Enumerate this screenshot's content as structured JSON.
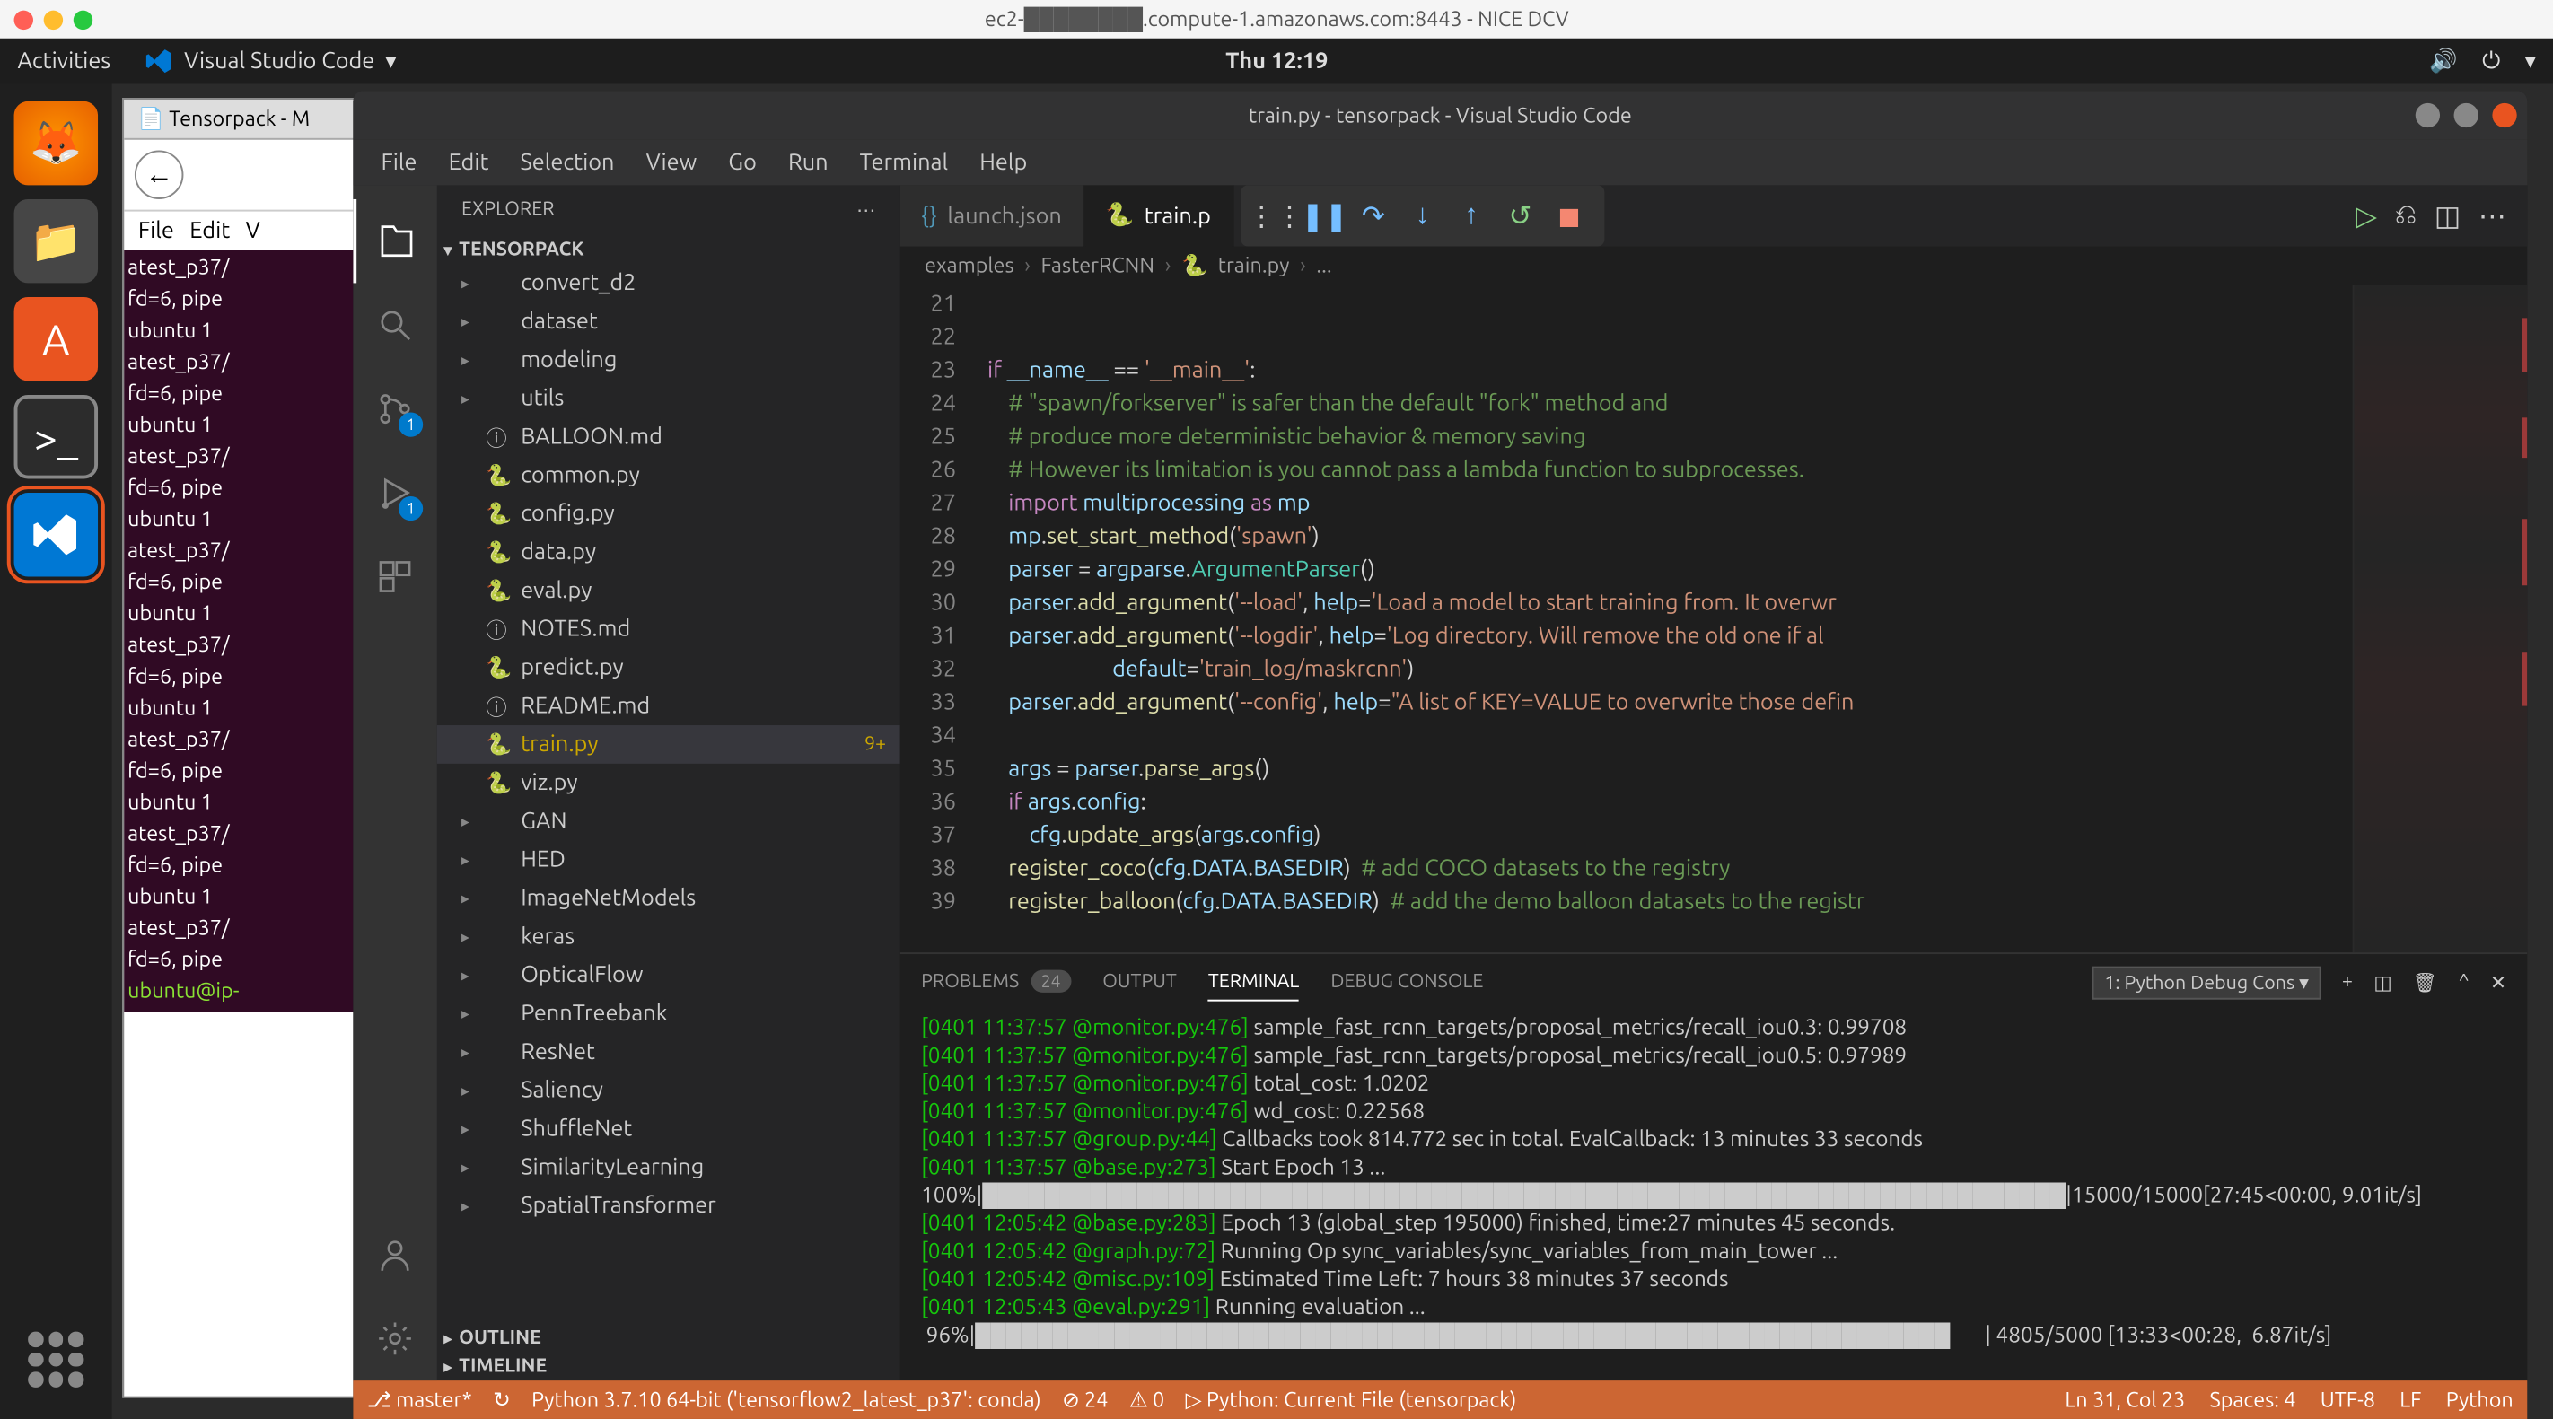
{
  "browser": {
    "title": "ec2-████████.compute-1.amazonaws.com:8443 - NICE DCV"
  },
  "ubuntu": {
    "activities": "Activities",
    "app_name": "Visual Studio Code",
    "time": "Thu 12:19"
  },
  "bg_window": {
    "tab": "Tensorpack - M",
    "menu": [
      "File",
      "Edit",
      "V"
    ],
    "terminal_lines": [
      "atest_p37/",
      "fd=6, pipe",
      "ubuntu   1",
      "atest_p37/",
      "fd=6, pipe",
      "ubuntu   1",
      "atest_p37/",
      "fd=6, pipe",
      "ubuntu   1",
      "atest_p37/",
      "fd=6, pipe",
      "ubuntu   1",
      "atest_p37/",
      "fd=6, pipe",
      "ubuntu   1",
      "atest_p37/",
      "fd=6, pipe",
      "ubuntu   1",
      "atest_p37/",
      "fd=6, pipe",
      "ubuntu   1",
      "atest_p37/",
      "fd=6, pipe",
      "ubuntu@ip-"
    ]
  },
  "vscode": {
    "title": "train.py - tensorpack - Visual Studio Code",
    "menus": [
      "File",
      "Edit",
      "Selection",
      "View",
      "Go",
      "Run",
      "Terminal",
      "Help"
    ],
    "explorer_title": "EXPLORER",
    "project": "TENSORPACK",
    "scm_badge": "1",
    "run_badge": "1",
    "tree": [
      {
        "name": "convert_d2",
        "type": "folder"
      },
      {
        "name": "dataset",
        "type": "folder"
      },
      {
        "name": "modeling",
        "type": "folder"
      },
      {
        "name": "utils",
        "type": "folder"
      },
      {
        "name": "BALLOON.md",
        "type": "file",
        "icon": "ⓘ"
      },
      {
        "name": "common.py",
        "type": "file",
        "icon": "🐍"
      },
      {
        "name": "config.py",
        "type": "file",
        "icon": "🐍"
      },
      {
        "name": "data.py",
        "type": "file",
        "icon": "🐍"
      },
      {
        "name": "eval.py",
        "type": "file",
        "icon": "🐍"
      },
      {
        "name": "NOTES.md",
        "type": "file",
        "icon": "ⓘ"
      },
      {
        "name": "predict.py",
        "type": "file",
        "icon": "🐍"
      },
      {
        "name": "README.md",
        "type": "file",
        "icon": "ⓘ"
      },
      {
        "name": "train.py",
        "type": "file",
        "icon": "🐍",
        "active": true,
        "modified": true,
        "badge": "9+"
      },
      {
        "name": "viz.py",
        "type": "file",
        "icon": "🐍"
      },
      {
        "name": "GAN",
        "type": "folder"
      },
      {
        "name": "HED",
        "type": "folder"
      },
      {
        "name": "ImageNetModels",
        "type": "folder"
      },
      {
        "name": "keras",
        "type": "folder"
      },
      {
        "name": "OpticalFlow",
        "type": "folder"
      },
      {
        "name": "PennTreebank",
        "type": "folder"
      },
      {
        "name": "ResNet",
        "type": "folder"
      },
      {
        "name": "Saliency",
        "type": "folder"
      },
      {
        "name": "ShuffleNet",
        "type": "folder"
      },
      {
        "name": "SimilarityLearning",
        "type": "folder"
      },
      {
        "name": "SpatialTransformer",
        "type": "folder"
      }
    ],
    "outline": "OUTLINE",
    "timeline": "TIMELINE",
    "tabs": [
      {
        "label": "launch.json",
        "icon": "{}"
      },
      {
        "label": "train.p",
        "icon": "🐍",
        "active": true
      }
    ],
    "breadcrumbs": [
      "examples",
      "FasterRCNN",
      "train.py",
      "..."
    ],
    "line_start": 21,
    "code_lines": [
      "",
      "",
      "<span class='kw'>if</span> <span class='var'>__name__</span> <span class='op'>==</span> <span class='str'>'__main__'</span>:",
      "    <span class='cmt'># \"spawn/forkserver\" is safer than the default \"fork\" method and</span>",
      "    <span class='cmt'># produce more deterministic behavior & memory saving</span>",
      "    <span class='cmt'># However its limitation is you cannot pass a lambda function to subprocesses.</span>",
      "    <span class='kw'>import</span> <span class='var'>multiprocessing</span> <span class='kw'>as</span> <span class='var'>mp</span>",
      "    <span class='var'>mp</span>.<span class='fn'>set_start_method</span>(<span class='str'>'spawn'</span>)",
      "    <span class='var'>parser</span> = <span class='var'>argparse</span>.<span class='cls'>ArgumentParser</span>()",
      "    <span class='var'>parser</span>.<span class='fn'>add_argument</span>(<span class='str'>'--load'</span>, <span class='var'>help</span>=<span class='str'>'Load a model to start training from. It overwr</span>",
      "    <span class='var'>parser</span>.<span class='fn'>add_argument</span>(<span class='str'>'--logdir'</span>, <span class='var'>help</span>=<span class='str'>'Log directory. Will remove the old one if al</span>",
      "                        <span class='var'>default</span>=<span class='str'>'train_log/maskrcnn'</span>)",
      "    <span class='var'>parser</span>.<span class='fn'>add_argument</span>(<span class='str'>'--config'</span>, <span class='var'>help</span>=<span class='str'>\"A list of KEY=VALUE to overwrite those defin</span>",
      "",
      "    <span class='var'>args</span> = <span class='var'>parser</span>.<span class='fn'>parse_args</span>()",
      "    <span class='kw'>if</span> <span class='var'>args</span>.<span class='var'>config</span>:",
      "        <span class='var'>cfg</span>.<span class='fn'>update_args</span>(<span class='var'>args</span>.<span class='var'>config</span>)",
      "    <span class='fn'>register_coco</span>(<span class='var'>cfg</span>.<span class='var'>DATA</span>.<span class='var'>BASEDIR</span>)  <span class='cmt'># add COCO datasets to the registry</span>",
      "    <span class='fn'>register_balloon</span>(<span class='var'>cfg</span>.<span class='var'>DATA</span>.<span class='var'>BASEDIR</span>)  <span class='cmt'># add the demo balloon datasets to the registr</span>"
    ],
    "panel": {
      "tabs": [
        "PROBLEMS",
        "OUTPUT",
        "TERMINAL",
        "DEBUG CONSOLE"
      ],
      "problems_count": "24",
      "active_tab": "TERMINAL",
      "selector": "1: Python Debug Cons",
      "lines": [
        {
          "ts": "[0401 11:37:57 @monitor.py:476]",
          "txt": " sample_fast_rcnn_targets/proposal_metrics/recall_iou0.3: 0.99708"
        },
        {
          "ts": "[0401 11:37:57 @monitor.py:476]",
          "txt": " sample_fast_rcnn_targets/proposal_metrics/recall_iou0.5: 0.97989"
        },
        {
          "ts": "[0401 11:37:57 @monitor.py:476]",
          "txt": " total_cost: 1.0202"
        },
        {
          "ts": "[0401 11:37:57 @monitor.py:476]",
          "txt": " wd_cost: 0.22568"
        },
        {
          "ts": "[0401 11:37:57 @group.py:44]",
          "txt": " Callbacks took 814.772 sec in total. EvalCallback: 13 minutes 33 seconds"
        },
        {
          "ts": "[0401 11:37:57 @base.py:273]",
          "txt": " Start Epoch 13 ..."
        },
        {
          "raw": "100%|██████████████████████████████████████████████████████████████████████|15000/15000[27:45<00:00, 9.01it/s]"
        },
        {
          "ts": "[0401 12:05:42 @base.py:283]",
          "txt": " Epoch 13 (global_step 195000) finished, time:27 minutes 45 seconds."
        },
        {
          "ts": "[0401 12:05:42 @graph.py:72]",
          "txt": " Running Op sync_variables/sync_variables_from_main_tower ..."
        },
        {
          "ts": "[0401 12:05:42 @misc.py:109]",
          "txt": " Estimated Time Left: 7 hours 38 minutes 37 seconds"
        },
        {
          "ts": "[0401 12:05:43 @eval.py:291]",
          "txt": " Running evaluation ..."
        },
        {
          "raw": " 96%|███████████████████████████████████████████████████████████████       | 4805/5000 [13:33<00:28,  6.87it/s]"
        }
      ]
    },
    "status": {
      "branch": "master*",
      "sync": "↻",
      "interpreter": "Python 3.7.10 64-bit ('tensorflow2_latest_p37': conda)",
      "errors": "⊘ 24",
      "warnings": "⚠ 0",
      "debug_target": "Python: Current File (tensorpack)",
      "position": "Ln 31, Col 23",
      "spaces": "Spaces: 4",
      "encoding": "UTF-8",
      "eol": "LF",
      "lang": "Python"
    }
  }
}
